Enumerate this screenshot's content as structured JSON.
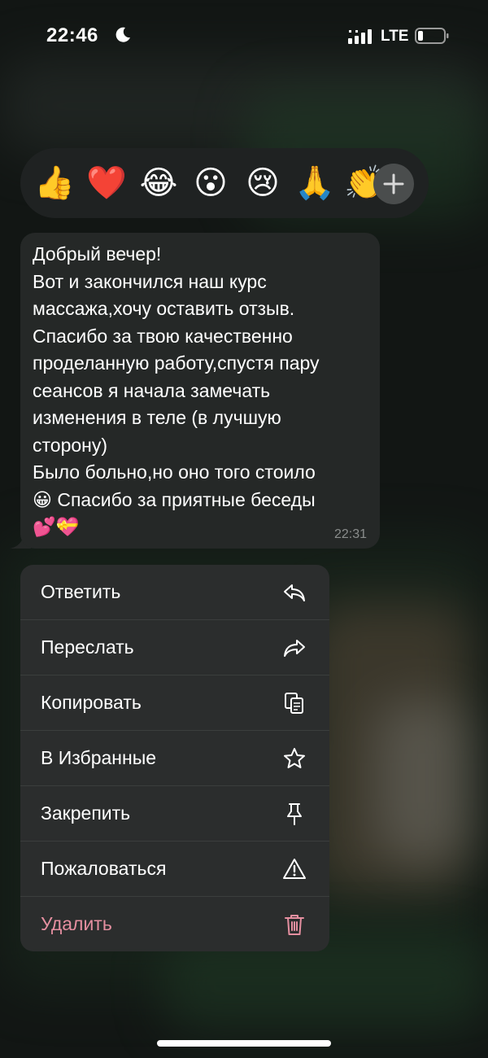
{
  "status_bar": {
    "time": "22:46",
    "network": "LTE",
    "icons": [
      "moon-icon",
      "signal-icon",
      "battery-icon"
    ]
  },
  "reactions": [
    {
      "emoji": "👍",
      "name": "thumbs-up"
    },
    {
      "emoji": "❤️",
      "name": "red-heart"
    },
    {
      "emoji": "😂",
      "name": "tears-of-joy"
    },
    {
      "emoji": "😮",
      "name": "surprised"
    },
    {
      "emoji": "😢",
      "name": "crying"
    },
    {
      "emoji": "🙏",
      "name": "folded-hands"
    },
    {
      "emoji": "👏",
      "name": "clapping"
    }
  ],
  "message": {
    "lines": [
      "Добрый вечер!",
      "Вот и закончился наш курс",
      "массажа,хочу оставить отзыв.",
      "Спасибо за твою качественно",
      "проделанную работу,спустя пару",
      "сеансов я начала замечать",
      "изменения в теле (в лучшую",
      "сторону)",
      "Было больно,но оно того стоило",
      "😀 Спасибо за приятные беседы",
      "💕💝"
    ],
    "time": "22:31"
  },
  "menu": {
    "items": [
      {
        "label": "Ответить",
        "icon": "reply-icon"
      },
      {
        "label": "Переслать",
        "icon": "forward-icon"
      },
      {
        "label": "Копировать",
        "icon": "copy-icon"
      },
      {
        "label": "В Избранные",
        "icon": "star-icon"
      },
      {
        "label": "Закрепить",
        "icon": "pin-icon"
      },
      {
        "label": "Пожаловаться",
        "icon": "warning-icon"
      },
      {
        "label": "Удалить",
        "icon": "trash-icon"
      }
    ]
  },
  "colors": {
    "danger": "#e58fa0",
    "menu_bg": "#2b2d2d",
    "bubble_bg": "#252827"
  }
}
